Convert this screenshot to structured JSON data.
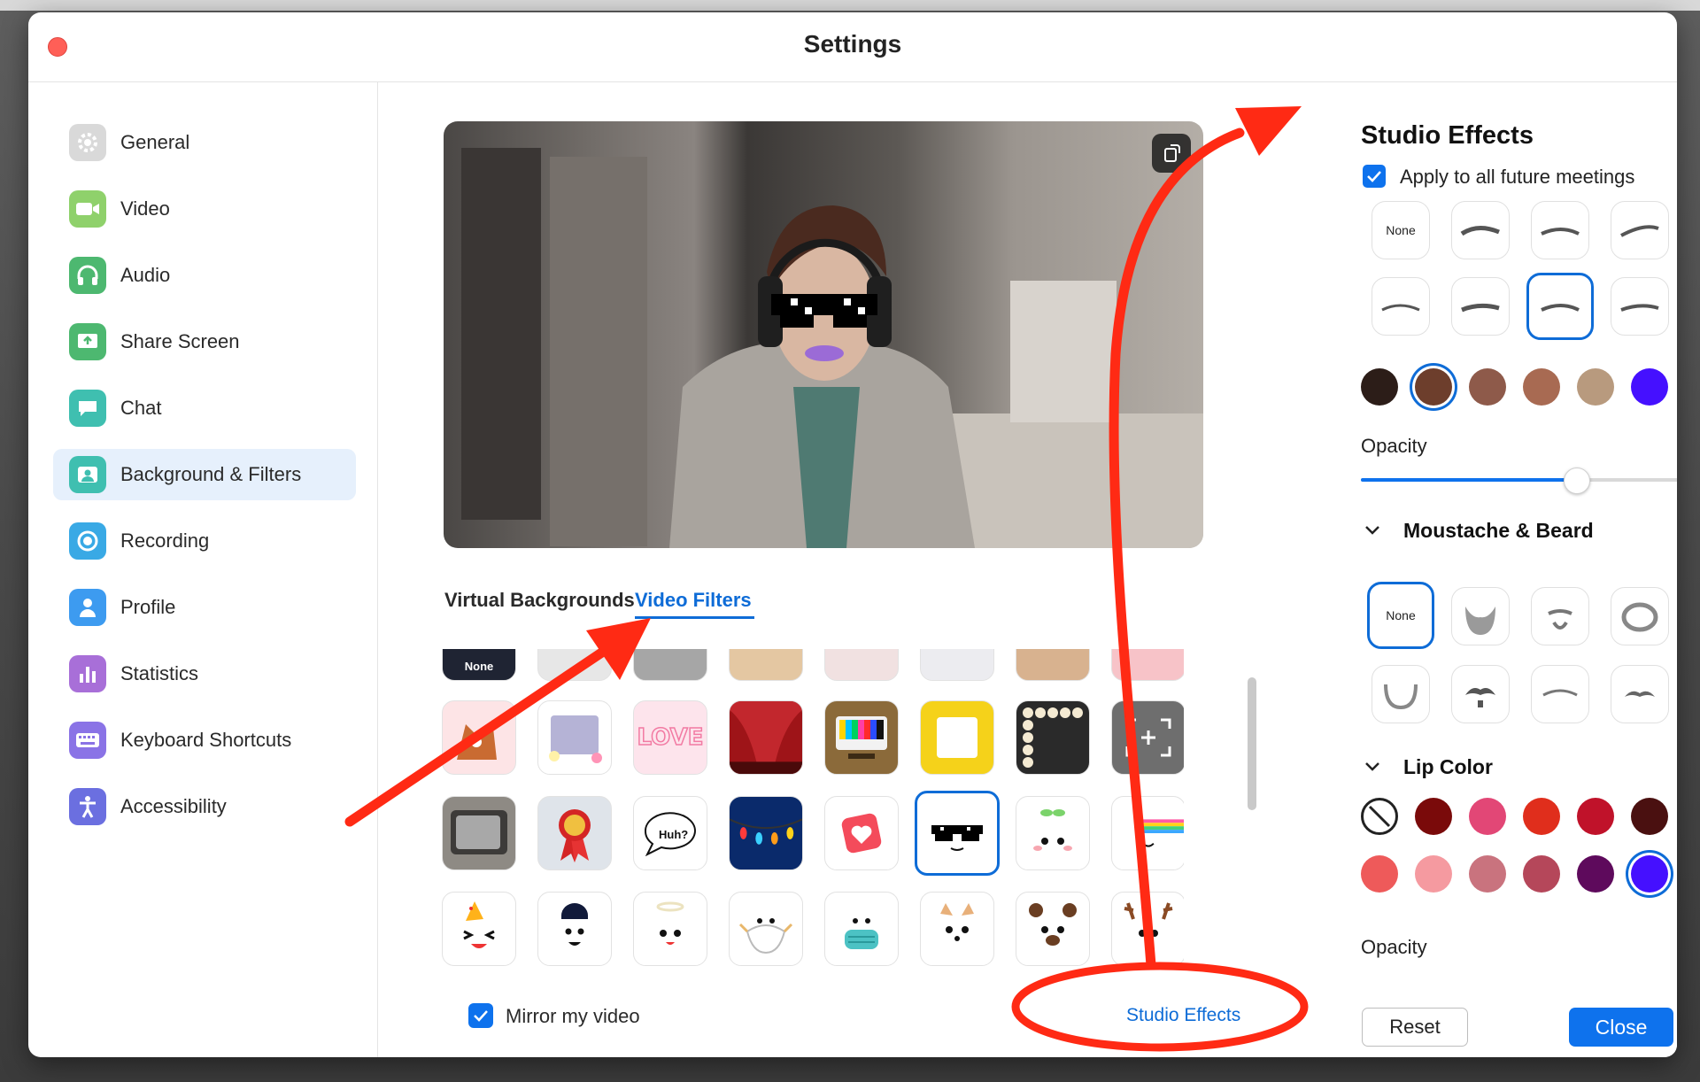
{
  "window": {
    "title": "Settings"
  },
  "sidebar": {
    "items": [
      {
        "label": "General",
        "icon": "gear-icon",
        "color": "#d9d9d9"
      },
      {
        "label": "Video",
        "icon": "video-camera-icon",
        "color": "#8fd16b"
      },
      {
        "label": "Audio",
        "icon": "headphones-icon",
        "color": "#4db870"
      },
      {
        "label": "Share Screen",
        "icon": "share-screen-icon",
        "color": "#4db870"
      },
      {
        "label": "Chat",
        "icon": "chat-bubble-icon",
        "color": "#3fbfb0"
      },
      {
        "label": "Background & Filters",
        "icon": "background-icon",
        "color": "#3fbfb0"
      },
      {
        "label": "Recording",
        "icon": "record-icon",
        "color": "#39a9e5"
      },
      {
        "label": "Profile",
        "icon": "profile-icon",
        "color": "#3d9bf0"
      },
      {
        "label": "Statistics",
        "icon": "statistics-icon",
        "color": "#a86fd8"
      },
      {
        "label": "Keyboard Shortcuts",
        "icon": "keyboard-icon",
        "color": "#8a73e6"
      },
      {
        "label": "Accessibility",
        "icon": "accessibility-icon",
        "color": "#6b6fe0"
      }
    ],
    "active_index": 5
  },
  "center": {
    "tabs": [
      {
        "label": "Virtual Backgrounds",
        "active": false
      },
      {
        "label": "Video Filters",
        "active": true
      }
    ],
    "filter_tiles": [
      {
        "label": "None",
        "icon": "none-tile"
      },
      {
        "label": "Huh?",
        "icon": "speech-bubble-tile"
      }
    ],
    "mirror_label": "Mirror my video",
    "studio_effects_link": "Studio Effects"
  },
  "right_panel": {
    "title": "Studio Effects",
    "apply_future_label": "Apply to all future meetings",
    "eyebrow_none_label": "None",
    "eyebrow_colors": [
      "#2c1d18",
      "#6d3e2c",
      "#8e5a4a",
      "#a86a52",
      "#b89a7e",
      "#4510ff"
    ],
    "eyebrow_selected_color_index": 1,
    "opacity_label": "Opacity",
    "opacity_value": 0.68,
    "moustache_heading": "Moustache & Beard",
    "moustache_none_label": "None",
    "lip_heading": "Lip Color",
    "lip_colors": [
      "none",
      "#7a0a0a",
      "#e24776",
      "#e02e1c",
      "#c0122a",
      "#4a1010",
      "#ee5a5a",
      "#f59aa0",
      "#c9737e",
      "#b5475a",
      "#5e0a5c",
      "#4510ff"
    ],
    "lip_selected_index": 11,
    "lip_opacity_label": "Opacity",
    "reset_label": "Reset",
    "close_label": "Close"
  }
}
